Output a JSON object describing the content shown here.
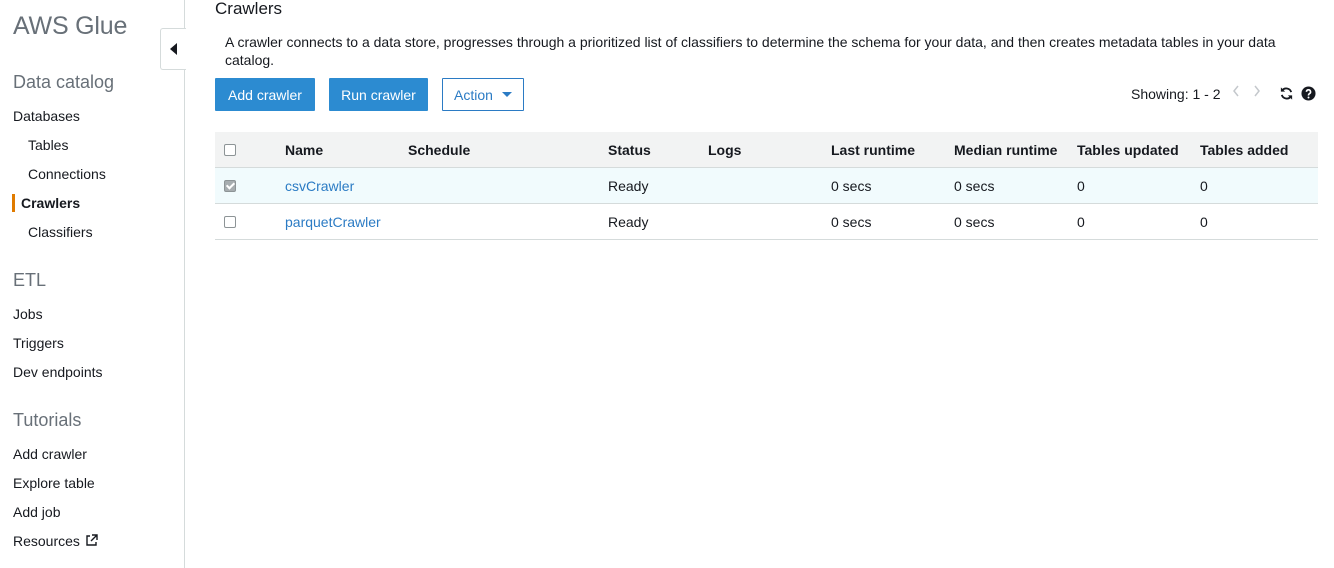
{
  "sidebar": {
    "app_title": "AWS Glue",
    "sections": [
      {
        "title": "Data catalog",
        "items": [
          "Databases",
          "Tables",
          "Connections",
          "Crawlers",
          "Classifiers"
        ]
      },
      {
        "title": "ETL",
        "items": [
          "Jobs",
          "Triggers",
          "Dev endpoints"
        ]
      },
      {
        "title": "Tutorials",
        "items": [
          "Add crawler",
          "Explore table",
          "Add job",
          "Resources"
        ]
      }
    ],
    "active_item": "Crawlers",
    "active_color": "#e07b00"
  },
  "main": {
    "title": "Crawlers",
    "description": "A crawler connects to a data store, progresses through a prioritized list of classifiers to determine the schema for your data, and then creates metadata tables in your data catalog.",
    "toolbar": {
      "add_label": "Add crawler",
      "run_label": "Run crawler",
      "action_label": "Action",
      "showing": "Showing: 1 - 2",
      "primary_color": "#2c8bd1"
    },
    "table": {
      "headers": [
        "Name",
        "Schedule",
        "Status",
        "Logs",
        "Last runtime",
        "Median runtime",
        "Tables updated",
        "Tables added"
      ],
      "rows": [
        {
          "name": "csvCrawler",
          "schedule": "",
          "status": "Ready",
          "logs": "",
          "last_runtime": "0 secs",
          "median_runtime": "0 secs",
          "tables_updated": "0",
          "tables_added": "0",
          "selected": true
        },
        {
          "name": "parquetCrawler",
          "schedule": "",
          "status": "Ready",
          "logs": "",
          "last_runtime": "0 secs",
          "median_runtime": "0 secs",
          "tables_updated": "0",
          "tables_added": "0",
          "selected": false
        }
      ]
    }
  },
  "icons": {
    "collapse": "collapse-sidebar-icon",
    "external": "external-link-icon",
    "prev": "chevron-left-icon",
    "next": "chevron-right-icon",
    "refresh": "refresh-icon",
    "help": "help-icon"
  }
}
